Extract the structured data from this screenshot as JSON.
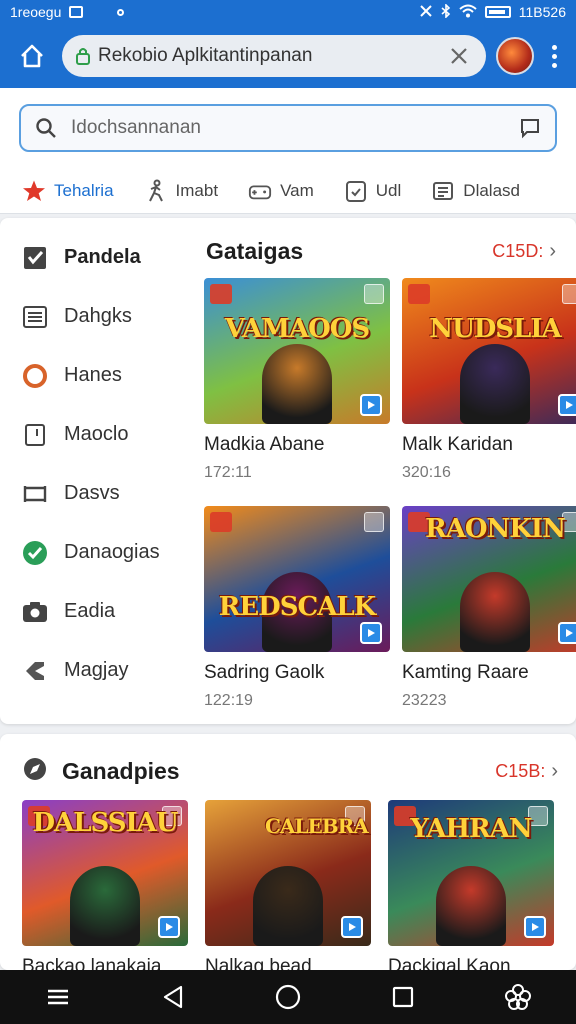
{
  "status_bar": {
    "left_text": "1reoegu",
    "right_text": "11B526"
  },
  "browser": {
    "url_text": "Rekobio Aplkitantinpanan"
  },
  "search": {
    "placeholder": "Idochsannanan"
  },
  "tabs": [
    {
      "label": "Tehalria",
      "icon": "star-icon",
      "active": true
    },
    {
      "label": "Imabt",
      "icon": "runner-icon"
    },
    {
      "label": "Vam",
      "icon": "controller-icon"
    },
    {
      "label": "Udl",
      "icon": "clipboard-icon"
    },
    {
      "label": "Dlalasd",
      "icon": "newspaper-icon"
    }
  ],
  "sidebar": {
    "items": [
      {
        "label": "Pandela",
        "icon": "checkbox-icon",
        "active": true
      },
      {
        "label": "Dahgks",
        "icon": "list-icon"
      },
      {
        "label": "Hanes",
        "icon": "ring-icon"
      },
      {
        "label": "Maoclo",
        "icon": "square-icon"
      },
      {
        "label": "Dasvs",
        "icon": "bracket-icon"
      },
      {
        "label": "Danaogias",
        "icon": "check-circle-icon"
      },
      {
        "label": "Eadia",
        "icon": "camera-icon"
      },
      {
        "label": "Magjay",
        "icon": "tag-icon"
      }
    ]
  },
  "section1": {
    "title": "Gataigas",
    "more_label": "C15D:",
    "games": [
      {
        "name": "Madkia Abane",
        "count": "172:11",
        "thumb_title": "VAMAOOS",
        "colors": [
          "#3b8fd6",
          "#7fc043",
          "#c77a2a"
        ]
      },
      {
        "name": "Malk Karidan",
        "count": "320:16",
        "thumb_title": "NUDSLIA",
        "colors": [
          "#f08a1c",
          "#c8321a",
          "#3a2a5a"
        ]
      },
      {
        "name": "Sadring Gaolk",
        "count": "122:19",
        "thumb_title": "REDSCALK",
        "colors": [
          "#f28b1a",
          "#1e4e9a",
          "#6b1b5a"
        ]
      },
      {
        "name": "Kamting Raare",
        "count": "23223",
        "thumb_title": "RAONKIN",
        "colors": [
          "#6a3fc6",
          "#2a7a3a",
          "#c43a2a"
        ]
      }
    ]
  },
  "section2": {
    "title": "Ganadpies",
    "more_label": "C15B:",
    "games": [
      {
        "name": "Backao lanakaia",
        "thumb_title": "DALSSIAU",
        "colors": [
          "#8a3fc6",
          "#e05a2a",
          "#2a6a3a"
        ]
      },
      {
        "name": "Nalkag bead",
        "thumb_title": "CALEBRA",
        "colors": [
          "#e6a23a",
          "#8a2a1a",
          "#3a2a1a"
        ]
      },
      {
        "name": "Dackigal Kaon",
        "thumb_title": "YAHRAN",
        "colors": [
          "#1e3a7a",
          "#3a8a5a",
          "#c43a2a"
        ]
      }
    ]
  },
  "colors": {
    "primary": "#1c6fd0",
    "accent_red": "#d8352a",
    "nav_bg": "#111111"
  }
}
